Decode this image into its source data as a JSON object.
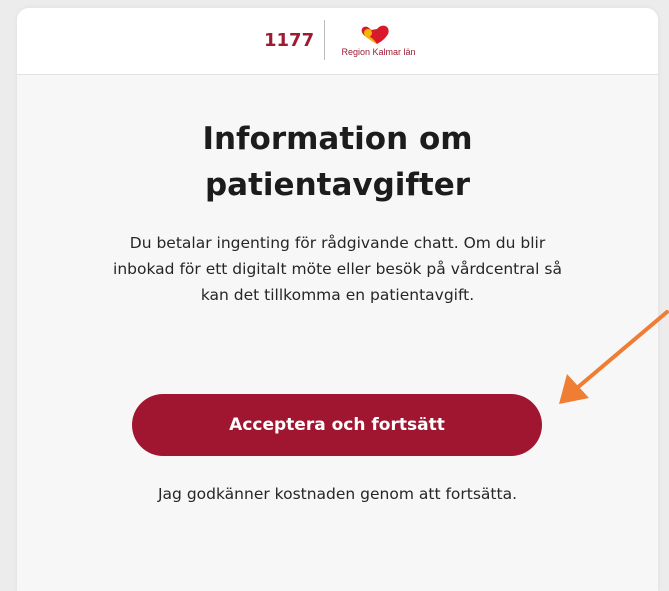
{
  "header": {
    "logo_text": "1177",
    "region_name": "Region Kalmar län"
  },
  "main": {
    "title_line1": "Information om",
    "title_line2": "patientavgifter",
    "body_line1": "Du betalar ingenting för rådgivande chatt. Om du blir",
    "body_line2": "inbokad för ett digitalt möte eller besök på vårdcentral så",
    "body_line3": "kan det tillkomma en patientavgift.",
    "accept_button_label": "Acceptera och fortsätt",
    "consent_text": "Jag godkänner kostnaden genom att fortsätta."
  },
  "colors": {
    "brand": "#a01530",
    "annotation_arrow": "#ef7d34"
  },
  "icons": {
    "region_logo": "heart-logo-icon",
    "annotation": "arrow-annotation-icon"
  }
}
